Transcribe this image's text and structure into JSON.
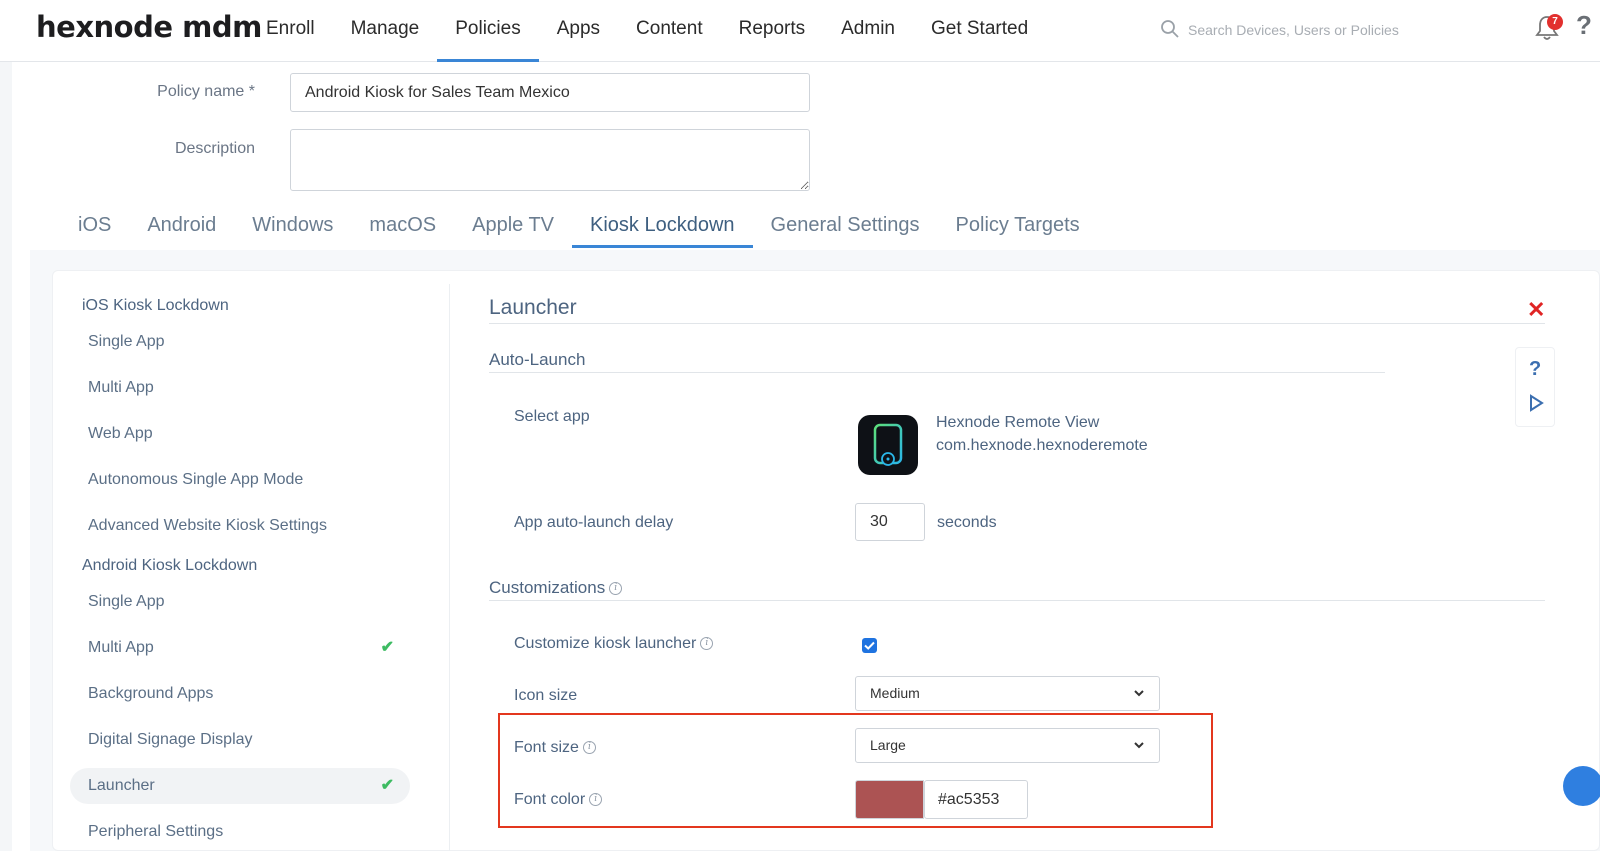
{
  "header": {
    "logo": "hexnode mdm",
    "nav": [
      "Enroll",
      "Manage",
      "Policies",
      "Apps",
      "Content",
      "Reports",
      "Admin",
      "Get Started"
    ],
    "active_nav": "Policies",
    "search_placeholder": "Search Devices, Users or Policies",
    "notification_count": "7",
    "help": "?"
  },
  "policy": {
    "name_label": "Policy name *",
    "name_value": "Android Kiosk for Sales Team Mexico",
    "description_label": "Description",
    "description_value": ""
  },
  "os_tabs": [
    "iOS",
    "Android",
    "Windows",
    "macOS",
    "Apple TV",
    "Kiosk Lockdown",
    "General Settings",
    "Policy Targets"
  ],
  "active_os_tab": "Kiosk Lockdown",
  "sidebar": {
    "ios_heading": "iOS Kiosk Lockdown",
    "ios_items": [
      "Single App",
      "Multi App",
      "Web App",
      "Autonomous Single App Mode",
      "Advanced Website Kiosk Settings"
    ],
    "android_heading": "Android Kiosk Lockdown",
    "android_items": [
      "Single App",
      "Multi App",
      "Background Apps",
      "Digital Signage Display",
      "Launcher",
      "Peripheral Settings"
    ],
    "checked_items": [
      "Multi App",
      "Launcher"
    ],
    "active_item": "Launcher"
  },
  "launcher": {
    "title": "Launcher",
    "auto_launch_title": "Auto-Launch",
    "select_app_label": "Select app",
    "app_name": "Hexnode Remote View",
    "app_package": "com.hexnode.hexnoderemote",
    "delay_label": "App auto-launch delay",
    "delay_value": "30",
    "delay_unit": "seconds",
    "customizations_title": "Customizations",
    "customize_label": "Customize kiosk launcher",
    "customize_checked": true,
    "icon_size_label": "Icon size",
    "icon_size_value": "Medium",
    "font_size_label": "Font size",
    "font_size_value": "Large",
    "font_color_label": "Font color",
    "font_color_value": "#ac5353"
  },
  "colors": {
    "accent": "#3a86d6",
    "font_color_swatch": "#ac5353",
    "highlight": "#e3371e",
    "check": "#3dbb62"
  }
}
